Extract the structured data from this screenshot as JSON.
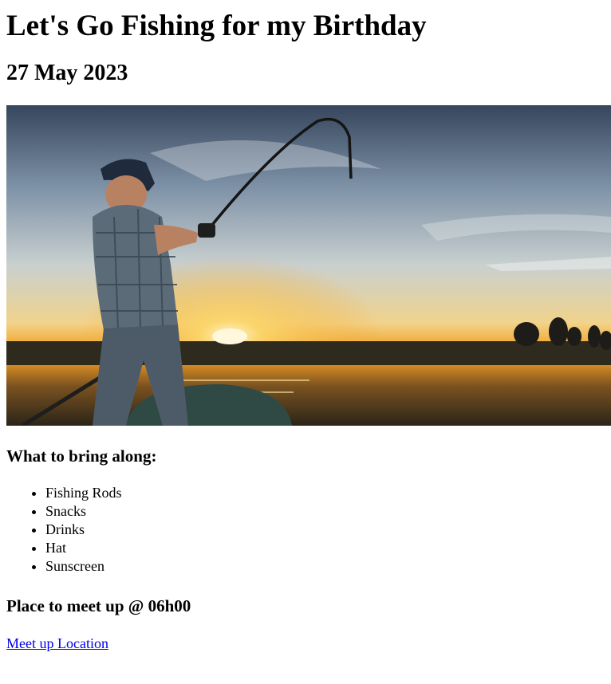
{
  "page": {
    "title": "Let's Go Fishing for my Birthday",
    "date": "27 May 2023"
  },
  "hero_image": {
    "alt": "Man fishing from a boat at sunset",
    "colors": {
      "sky_top": "#3d4a5e",
      "sky_mid": "#a9b8c6",
      "sun_glow": "#f4b23a",
      "horizon": "#e98b1e",
      "water": "#3a2c18"
    }
  },
  "bring": {
    "heading": "What to bring along:",
    "items": [
      "Fishing Rods",
      "Snacks",
      "Drinks",
      "Hat",
      "Sunscreen"
    ]
  },
  "meetup": {
    "heading": "Place to meet up @ 06h00",
    "link_label": "Meet up Location"
  }
}
